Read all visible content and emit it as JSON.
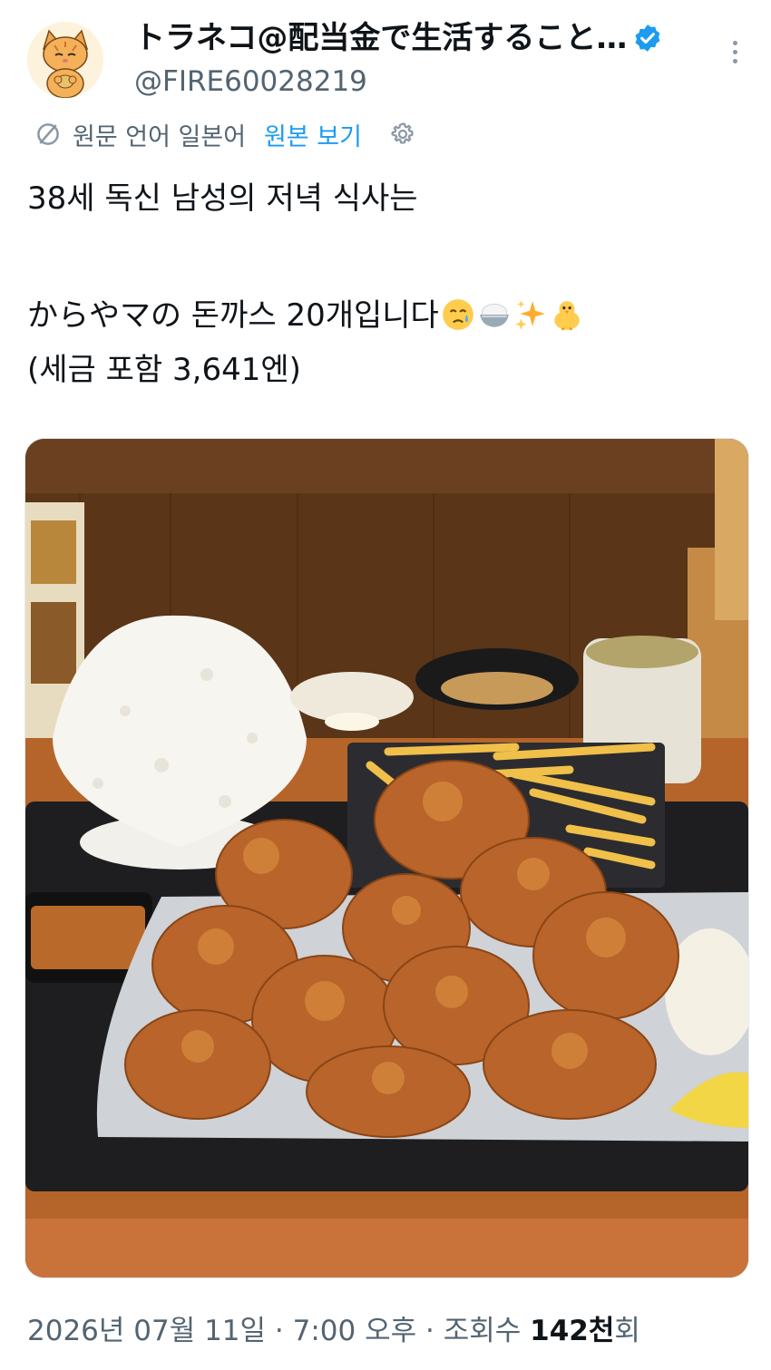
{
  "author": {
    "display_name": "トラネコ@配当金で生活すること…",
    "handle": "@FIRE60028219",
    "verified": true,
    "avatar_icon": "cat-avatar-icon"
  },
  "translation": {
    "original_language_label": "원문 언어 일본어",
    "view_original_label": "원본 보기",
    "icons": [
      "translate-icon",
      "gear-icon"
    ]
  },
  "tweet": {
    "line1": "38세 독신 남성의 저녁 식사는",
    "line2": "からやマの 돈까스 20개입니다",
    "line2_emojis": [
      "crying-face-emoji",
      "rice-bowl-emoji",
      "sparkles-emoji",
      "chick-emoji"
    ],
    "line3": "(세금 포함 3,641엔)"
  },
  "media": {
    "photo_icon": "fried-chicken-meal-photo"
  },
  "meta": {
    "date": "2026년 07월 11일",
    "time": "7:00 오후",
    "views_label": "조회수",
    "views_count": "142천",
    "views_suffix": "회",
    "separator": "·"
  },
  "colors": {
    "accent": "#1d9bf0",
    "secondary_text": "#536471",
    "primary_text": "#0f1419"
  }
}
